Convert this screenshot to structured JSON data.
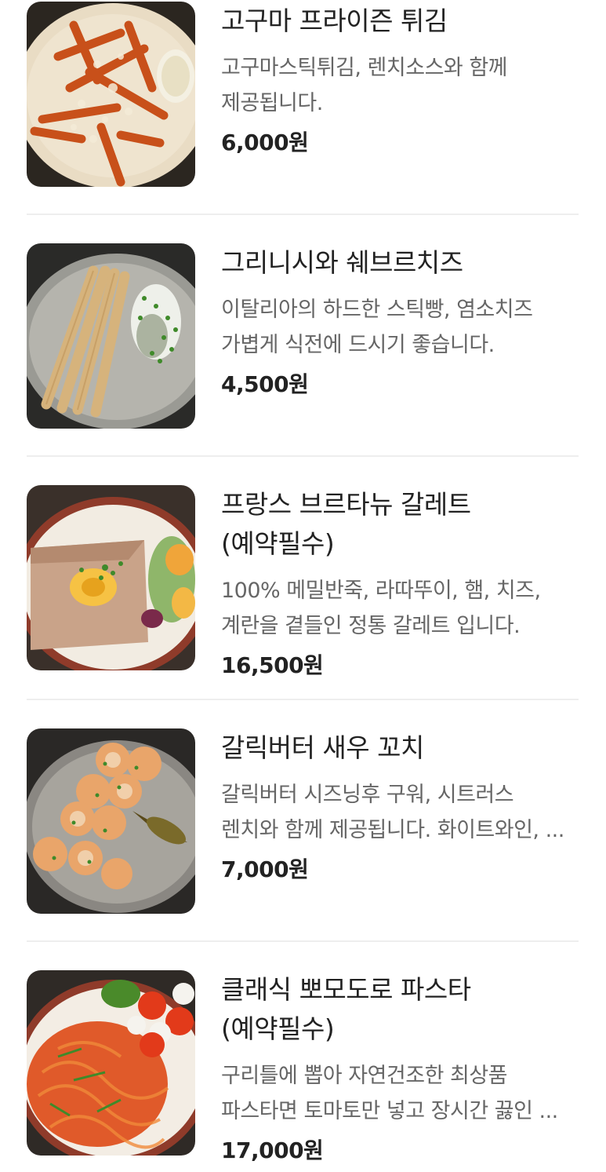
{
  "menu": {
    "items": [
      {
        "name": "고구마 프라이즌 튀김",
        "description": "고구마스틱튀김, 렌치소스와 함께 제공됩니다.",
        "price": "6,000원",
        "image_icon": "sweet-potato-fries-photo"
      },
      {
        "name": "그리니시와 쉐브르치즈",
        "description": "이탈리아의 하드한 스틱빵, 염소치즈 가볍게 식전에 드시기 좋습니다.",
        "price": "4,500원",
        "image_icon": "grissini-cheese-photo"
      },
      {
        "name": "프랑스 브르타뉴 갈레트(예약필수)",
        "description": "100% 메밀반죽, 라따뚜이, 햄, 치즈, 계란을 곁들인 정통 갈레트 입니다.",
        "price": "16,500원",
        "image_icon": "galette-photo"
      },
      {
        "name": "갈릭버터 새우 꼬치",
        "description": "갈릭버터 시즈닝후 구워, 시트러스 렌치와 함께 제공됩니다. 화이트와인, ...",
        "price": "7,000원",
        "image_icon": "garlic-shrimp-skewer-photo"
      },
      {
        "name": "클래식 뽀모도로 파스타 (예약필수)",
        "description": "구리틀에 뽑아 자연건조한 최상품 파스타면 토마토만 넣고 장시간 끓인 ...",
        "price": "17,000원",
        "image_icon": "pomodoro-pasta-photo"
      }
    ]
  }
}
